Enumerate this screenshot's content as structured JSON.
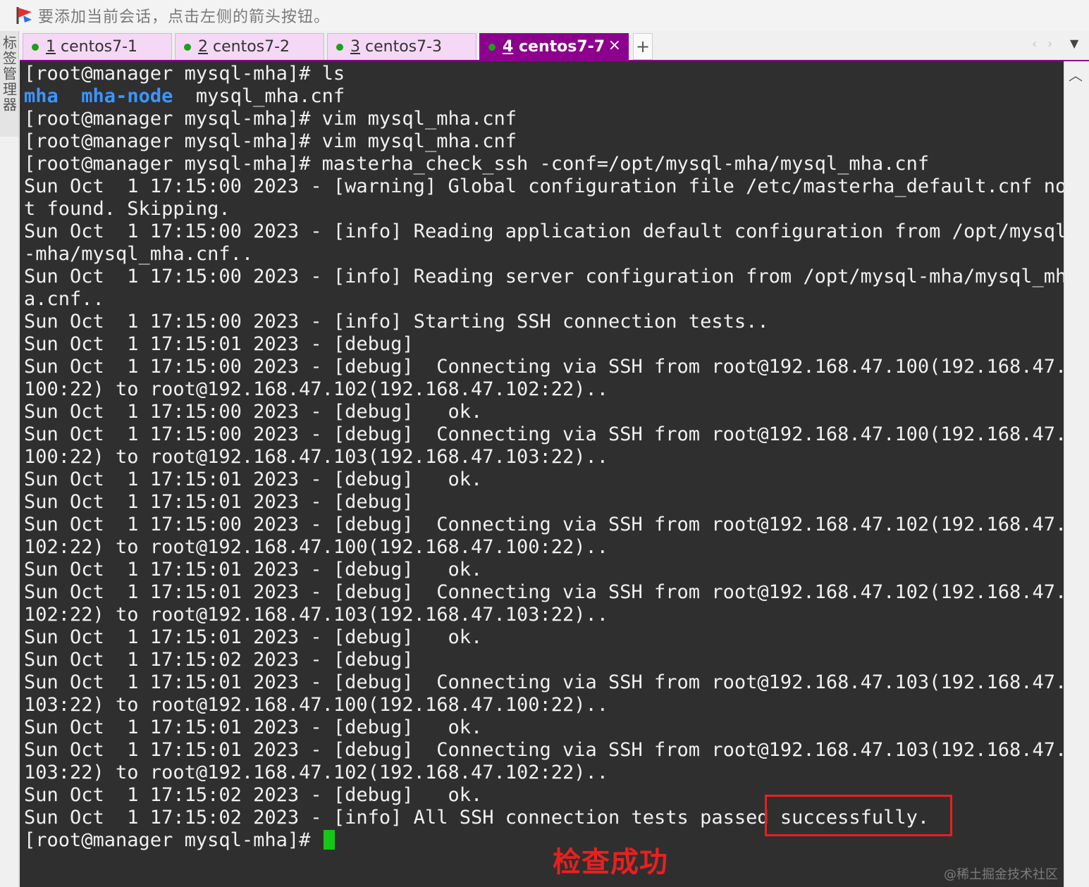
{
  "hint_bar": {
    "icon": "session-flag-icon",
    "text": "要添加当前会话，点击左侧的箭头按钮。"
  },
  "side_tab": {
    "label": "标签管理器"
  },
  "tabs": [
    {
      "number": "1",
      "name": "centos7-1",
      "status_color": "#17a317",
      "active": false
    },
    {
      "number": "2",
      "name": "centos7-2",
      "status_color": "#17a317",
      "active": false
    },
    {
      "number": "3",
      "name": "centos7-3",
      "status_color": "#17a317",
      "active": false
    },
    {
      "number": "4",
      "name": "centos7-7",
      "status_color": "#17a317",
      "active": true
    }
  ],
  "tab_controls": {
    "close": "×",
    "add": "+",
    "prev": "‹",
    "next": "›",
    "menu": "▼"
  },
  "terminal": {
    "lines": [
      "[root@manager mysql-mha]# ls",
      "__LS__",
      "[root@manager mysql-mha]# vim mysql_mha.cnf",
      "[root@manager mysql-mha]# vim mysql_mha.cnf",
      "[root@manager mysql-mha]# masterha_check_ssh -conf=/opt/mysql-mha/mysql_mha.cnf",
      "Sun Oct  1 17:15:00 2023 - [warning] Global configuration file /etc/masterha_default.cnf no",
      "t found. Skipping.",
      "Sun Oct  1 17:15:00 2023 - [info] Reading application default configuration from /opt/mysql",
      "-mha/mysql_mha.cnf..",
      "Sun Oct  1 17:15:00 2023 - [info] Reading server configuration from /opt/mysql-mha/mysql_mh",
      "a.cnf..",
      "Sun Oct  1 17:15:00 2023 - [info] Starting SSH connection tests..",
      "Sun Oct  1 17:15:01 2023 - [debug]",
      "Sun Oct  1 17:15:00 2023 - [debug]  Connecting via SSH from root@192.168.47.100(192.168.47.",
      "100:22) to root@192.168.47.102(192.168.47.102:22)..",
      "Sun Oct  1 17:15:00 2023 - [debug]   ok.",
      "Sun Oct  1 17:15:00 2023 - [debug]  Connecting via SSH from root@192.168.47.100(192.168.47.",
      "100:22) to root@192.168.47.103(192.168.47.103:22)..",
      "Sun Oct  1 17:15:01 2023 - [debug]   ok.",
      "Sun Oct  1 17:15:01 2023 - [debug]",
      "Sun Oct  1 17:15:00 2023 - [debug]  Connecting via SSH from root@192.168.47.102(192.168.47.",
      "102:22) to root@192.168.47.100(192.168.47.100:22)..",
      "Sun Oct  1 17:15:01 2023 - [debug]   ok.",
      "Sun Oct  1 17:15:01 2023 - [debug]  Connecting via SSH from root@192.168.47.102(192.168.47.",
      "102:22) to root@192.168.47.103(192.168.47.103:22)..",
      "Sun Oct  1 17:15:01 2023 - [debug]   ok.",
      "Sun Oct  1 17:15:02 2023 - [debug]",
      "Sun Oct  1 17:15:01 2023 - [debug]  Connecting via SSH from root@192.168.47.103(192.168.47.",
      "103:22) to root@192.168.47.100(192.168.47.100:22)..",
      "Sun Oct  1 17:15:01 2023 - [debug]   ok.",
      "Sun Oct  1 17:15:01 2023 - [debug]  Connecting via SSH from root@192.168.47.103(192.168.47.",
      "103:22) to root@192.168.47.102(192.168.47.102:22)..",
      "Sun Oct  1 17:15:02 2023 - [debug]   ok.",
      "Sun Oct  1 17:15:02 2023 - [info] All SSH connection tests passed successfully."
    ],
    "ls_output": {
      "dirs": [
        "mha",
        "mha-node"
      ],
      "files": [
        "mysql_mha.cnf"
      ],
      "dir_color": "#3b95ff"
    },
    "prompt": "[root@manager mysql-mha]# ",
    "cursor_color": "#17c617"
  },
  "annotation": {
    "text": "检查成功",
    "color": "#e82020"
  },
  "watermark": "@稀土掘金技术社区"
}
